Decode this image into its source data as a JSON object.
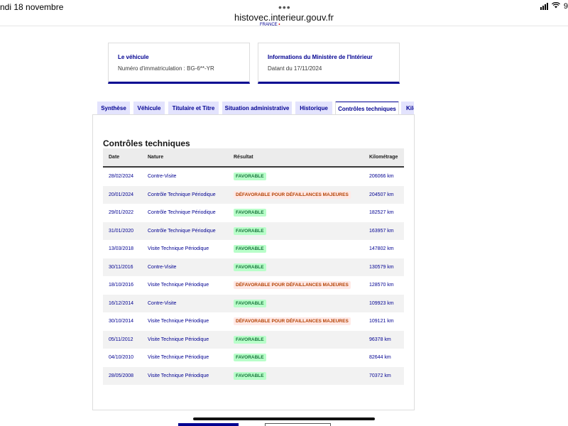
{
  "status_bar": {
    "date": "ndi 18 novembre",
    "url": "histovec.interieur.gouv.fr",
    "dots": "•••",
    "battery": "9"
  },
  "logo_fragment": {
    "text": "FRANCE",
    "mark": "•"
  },
  "cards": [
    {
      "title": "Le véhicule",
      "text": "Numéro d'immatriculation : BG-6**-YR"
    },
    {
      "title": "Informations du Ministère de l'Intérieur",
      "text": "Datant du 17/11/2024"
    }
  ],
  "tabs": [
    {
      "label": "Synthèse",
      "active": false
    },
    {
      "label": "Véhicule",
      "active": false
    },
    {
      "label": "Titulaire et Titre",
      "active": false
    },
    {
      "label": "Situation administrative",
      "active": false
    },
    {
      "label": "Historique",
      "active": false
    },
    {
      "label": "Contrôles techniques",
      "active": true
    },
    {
      "label": "Kilométrage",
      "active": false
    }
  ],
  "section": {
    "title": "Contrôles techniques",
    "columns": [
      "Date",
      "Nature",
      "Résultat",
      "Kilométrage"
    ],
    "rows": [
      {
        "date": "28/02/2024",
        "nature": "Contre-Visite",
        "result": "FAVORABLE",
        "status": "ok",
        "km": "206066 km"
      },
      {
        "date": "20/01/2024",
        "nature": "Contrôle Technique Périodique",
        "result": "DÉFAVORABLE POUR DÉFAILLANCES MAJEURES",
        "status": "ko",
        "km": "204507 km"
      },
      {
        "date": "29/01/2022",
        "nature": "Contrôle Technique Périodique",
        "result": "FAVORABLE",
        "status": "ok",
        "km": "182527 km"
      },
      {
        "date": "31/01/2020",
        "nature": "Contrôle Technique Périodique",
        "result": "FAVORABLE",
        "status": "ok",
        "km": "163957 km"
      },
      {
        "date": "13/03/2018",
        "nature": "Visite Technique Périodique",
        "result": "FAVORABLE",
        "status": "ok",
        "km": "147802 km"
      },
      {
        "date": "30/11/2016",
        "nature": "Contre-Visite",
        "result": "FAVORABLE",
        "status": "ok",
        "km": "130579 km"
      },
      {
        "date": "18/10/2016",
        "nature": "Visite Technique Périodique",
        "result": "DÉFAVORABLE POUR DÉFAILLANCES MAJEURES",
        "status": "ko",
        "km": "128570 km"
      },
      {
        "date": "16/12/2014",
        "nature": "Contre-Visite",
        "result": "FAVORABLE",
        "status": "ok",
        "km": "109923 km"
      },
      {
        "date": "30/10/2014",
        "nature": "Visite Technique Périodique",
        "result": "DÉFAVORABLE POUR DÉFAILLANCES MAJEURES",
        "status": "ko",
        "km": "109121 km"
      },
      {
        "date": "05/11/2012",
        "nature": "Visite Technique Périodique",
        "result": "FAVORABLE",
        "status": "ok",
        "km": "96378 km"
      },
      {
        "date": "04/10/2010",
        "nature": "Visite Technique Périodique",
        "result": "FAVORABLE",
        "status": "ok",
        "km": "82644 km"
      },
      {
        "date": "28/05/2008",
        "nature": "Visite Technique Périodique",
        "result": "FAVORABLE",
        "status": "ok",
        "km": "70372 km"
      }
    ]
  },
  "colors": {
    "brand_blue": "#000091",
    "tab_bg": "#e3e3fd",
    "success_bg": "#b8fec9",
    "success_text": "#18753c",
    "error_bg": "#ffe9e6",
    "error_text": "#b34000"
  },
  "icons": [
    "signal-icon",
    "wifi-icon"
  ]
}
